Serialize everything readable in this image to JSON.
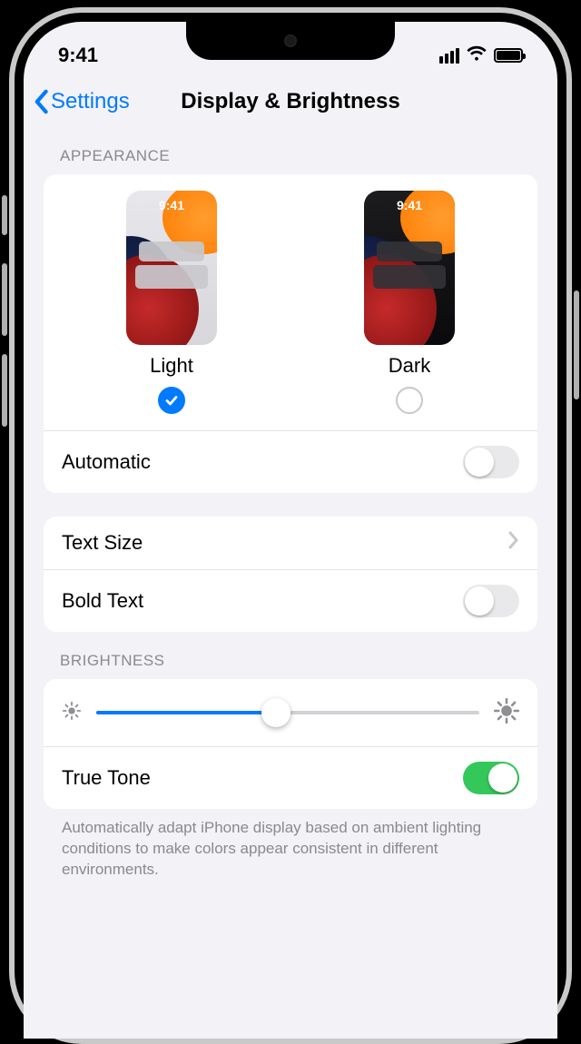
{
  "status": {
    "time": "9:41"
  },
  "nav": {
    "back": "Settings",
    "title": "Display & Brightness"
  },
  "sections": {
    "appearance": {
      "header": "APPEARANCE",
      "options": {
        "light": {
          "label": "Light",
          "thumb_time": "9:41",
          "selected": true
        },
        "dark": {
          "label": "Dark",
          "thumb_time": "9:41",
          "selected": false
        }
      },
      "automatic": {
        "label": "Automatic",
        "on": false
      }
    },
    "text": {
      "text_size": {
        "label": "Text Size"
      },
      "bold_text": {
        "label": "Bold Text",
        "on": false
      }
    },
    "brightness": {
      "header": "BRIGHTNESS",
      "slider_value": 0.47,
      "true_tone": {
        "label": "True Tone",
        "on": true
      },
      "footer": "Automatically adapt iPhone display based on ambient lighting conditions to make colors appear consistent in different environments."
    }
  }
}
